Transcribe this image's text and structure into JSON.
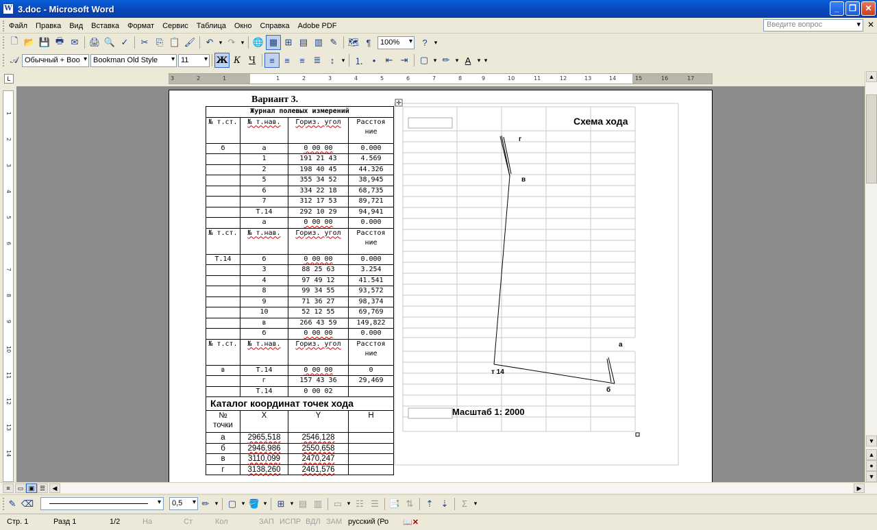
{
  "window": {
    "title": "3.doc - Microsoft Word",
    "app_icon": "W",
    "minimize_icon": "_",
    "restore_icon": "❐",
    "close_icon": "✕"
  },
  "menu": {
    "items": [
      "Файл",
      "Правка",
      "Вид",
      "Вставка",
      "Формат",
      "Сервис",
      "Таблица",
      "Окно",
      "Справка",
      "Adobe PDF"
    ],
    "question_placeholder": "Введите вопрос",
    "close_doc": "✕"
  },
  "toolbar_standard": {
    "zoom": "100%"
  },
  "toolbar_format": {
    "style": "Обычный + Boo",
    "font": "Bookman Old Style",
    "size": "11",
    "bold": "Ж",
    "italic": "К",
    "underline": "Ч"
  },
  "ruler": {
    "ticks": [
      "3",
      "2",
      "1",
      "1",
      "2",
      "3",
      "4",
      "5",
      "6",
      "7",
      "8",
      "9",
      "10",
      "11",
      "12",
      "13",
      "14",
      "15",
      "16",
      "17"
    ]
  },
  "vruler": {
    "ticks": [
      "1",
      "2",
      "3",
      "4",
      "5",
      "6",
      "7",
      "8",
      "9",
      "10",
      "11",
      "12",
      "13",
      "14"
    ]
  },
  "document": {
    "heading": "Вариант 3.",
    "journal_title": "Журнал полевых измерений",
    "blocks": [
      {
        "header": [
          "№ т.ст.",
          "№ т.нав.",
          "Гориз. угол",
          "Расстоя ние"
        ],
        "rows": [
          [
            "б",
            "а",
            "0 00 00",
            "0.000"
          ],
          [
            "",
            "1",
            "191 21 43",
            "4.569"
          ],
          [
            "",
            "2",
            "198 40 45",
            "44.326"
          ],
          [
            "",
            "5",
            "355 34 52",
            "38,945"
          ],
          [
            "",
            "6",
            "334 22 18",
            "68,735"
          ],
          [
            "",
            "7",
            "312 17 53",
            "89,721"
          ],
          [
            "",
            "Т.14",
            "292 10 29",
            "94,941"
          ],
          [
            "",
            "а",
            "0 00 00",
            "0.000"
          ]
        ]
      },
      {
        "header": [
          "№ т.ст.",
          "№ т.нав.",
          "Гориз. угол",
          "Расстоя ние"
        ],
        "rows": [
          [
            "Т.14",
            "б",
            "0 00 00",
            "0.000"
          ],
          [
            "",
            "3",
            "88 25 63",
            "3.254"
          ],
          [
            "",
            "4",
            "97 49 12",
            "41.541"
          ],
          [
            "",
            "8",
            "99 34 55",
            "93,572"
          ],
          [
            "",
            "9",
            "71 36 27",
            "98,374"
          ],
          [
            "",
            "10",
            "52 12 55",
            "69,769"
          ],
          [
            "",
            "в",
            "266 43 59",
            "149,822"
          ],
          [
            "",
            "б",
            "0 00 00",
            "0.000"
          ]
        ]
      },
      {
        "header": [
          "№ т.ст.",
          "№ т.нав.",
          "Гориз. угол",
          "Расстоя ние"
        ],
        "rows": [
          [
            "в",
            "Т.14",
            "0 00 00",
            "0"
          ],
          [
            "",
            "г",
            "157 43 36",
            "29,469"
          ],
          [
            "",
            "Т.14",
            "0 00 02",
            ""
          ]
        ]
      }
    ],
    "catalog": {
      "title": "Каталог координат точек хода",
      "header": [
        "№ точки",
        "X",
        "Y",
        "H"
      ],
      "rows": [
        [
          "а",
          "2965,518",
          "2546,128",
          ""
        ],
        [
          "б",
          "2946,986",
          "2550,658",
          ""
        ],
        [
          "в",
          "3110,099",
          "2470,247",
          ""
        ],
        [
          "г",
          "3138,260",
          "2461,576",
          ""
        ]
      ]
    },
    "scheme": {
      "title": "Схема хода",
      "scale": "Масштаб 1: 2000",
      "labels": {
        "a": "а",
        "b": "б",
        "v": "в",
        "g": "г",
        "t14": "т 14"
      }
    }
  },
  "drawbar": {
    "line_width": "0,5"
  },
  "status": {
    "page": "Стр. 1",
    "section": "Разд 1",
    "pages": "1/2",
    "at": "На",
    "line": "Ст",
    "col": "Кол",
    "rec": "ЗАП",
    "trk": "ИСПР",
    "ext": "ВДЛ",
    "ovr": "ЗАМ",
    "lang": "русский (Ро"
  }
}
